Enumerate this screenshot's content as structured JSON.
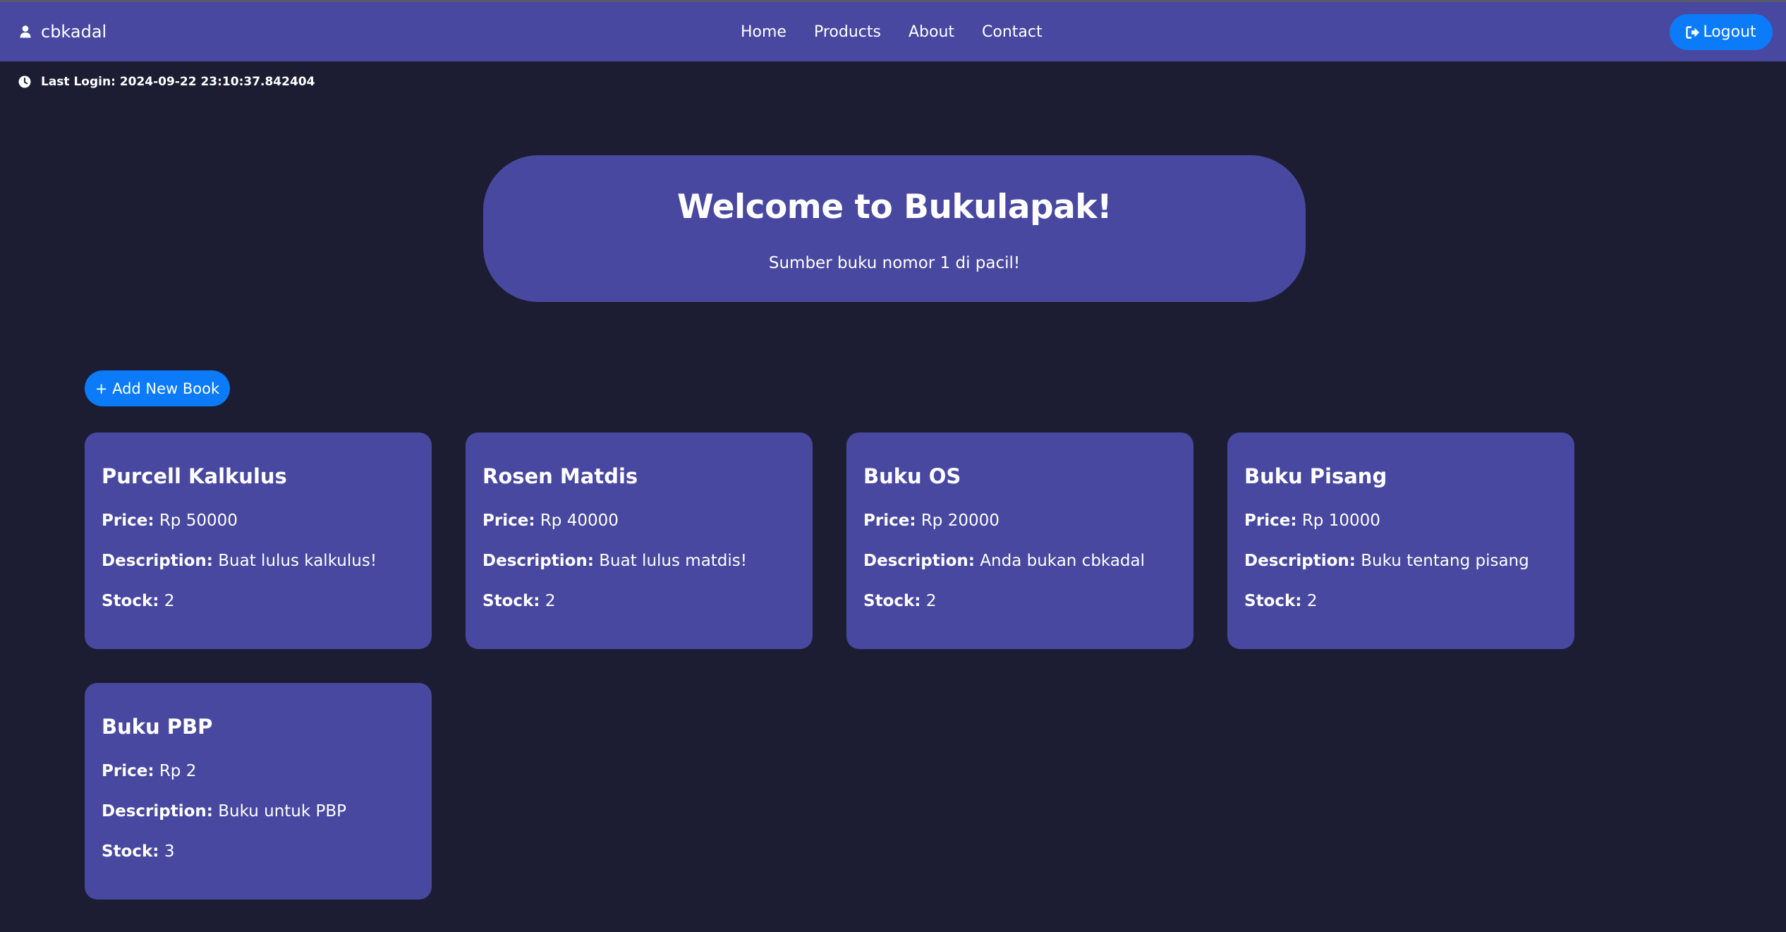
{
  "navbar": {
    "username": "cbkadal",
    "links": [
      "Home",
      "Products",
      "About",
      "Contact"
    ],
    "logout_label": "Logout"
  },
  "last_login": "Last Login: 2024-09-22 23:10:37.842404",
  "hero": {
    "title": "Welcome to Bukulapak!",
    "subtitle": "Sumber buku nomor 1 di pacil!"
  },
  "add_book_label": "+ Add New Book",
  "labels": {
    "price": "Price:",
    "description": "Description:",
    "stock": "Stock:"
  },
  "books": [
    {
      "title": "Purcell Kalkulus",
      "price": "Rp 50000",
      "description": "Buat lulus kalkulus!",
      "stock": "2"
    },
    {
      "title": "Rosen Matdis",
      "price": "Rp 40000",
      "description": "Buat lulus matdis!",
      "stock": "2"
    },
    {
      "title": "Buku OS",
      "price": "Rp 20000",
      "description": "Anda bukan cbkadal",
      "stock": "2"
    },
    {
      "title": "Buku Pisang",
      "price": "Rp 10000",
      "description": "Buku tentang pisang",
      "stock": "2"
    },
    {
      "title": "Buku PBP",
      "price": "Rp 2",
      "description": "Buku untuk PBP",
      "stock": "3"
    }
  ],
  "colors": {
    "background": "#1c1d32",
    "panel": "#4848a0",
    "accent": "#0b7bfa",
    "text": "#ffffff"
  }
}
